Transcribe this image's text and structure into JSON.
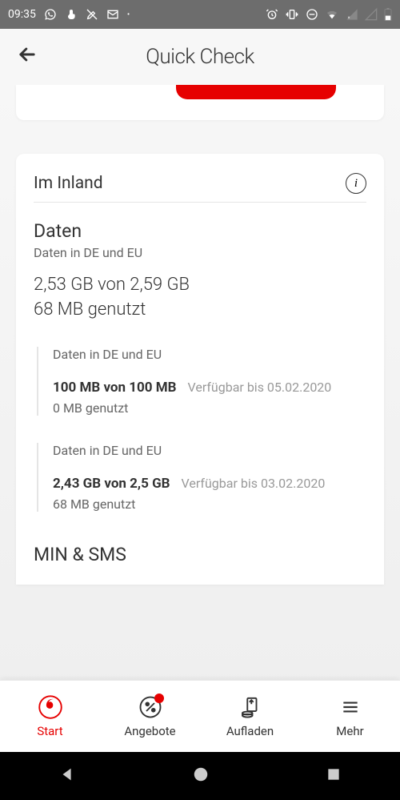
{
  "status": {
    "time": "09:35"
  },
  "header": {
    "title": "Quick Check"
  },
  "card": {
    "title": "Im Inland",
    "data": {
      "title": "Daten",
      "scope": "Daten in DE und EU",
      "summary_line1": "2,53 GB von 2,59 GB",
      "summary_line2": "68 MB genutzt",
      "buckets": [
        {
          "scope": "Daten in DE und EU",
          "main": "100 MB von 100 MB",
          "avail": "Verfügbar bis 05.02.2020",
          "used": "0 MB genutzt"
        },
        {
          "scope": "Daten in DE und EU",
          "main": "2,43 GB von 2,5 GB",
          "avail": "Verfügbar bis 03.02.2020",
          "used": "68 MB genutzt"
        }
      ]
    },
    "minsms": {
      "title": "MIN & SMS"
    }
  },
  "nav": {
    "items": [
      {
        "label": "Start"
      },
      {
        "label": "Angebote"
      },
      {
        "label": "Aufladen"
      },
      {
        "label": "Mehr"
      }
    ]
  }
}
